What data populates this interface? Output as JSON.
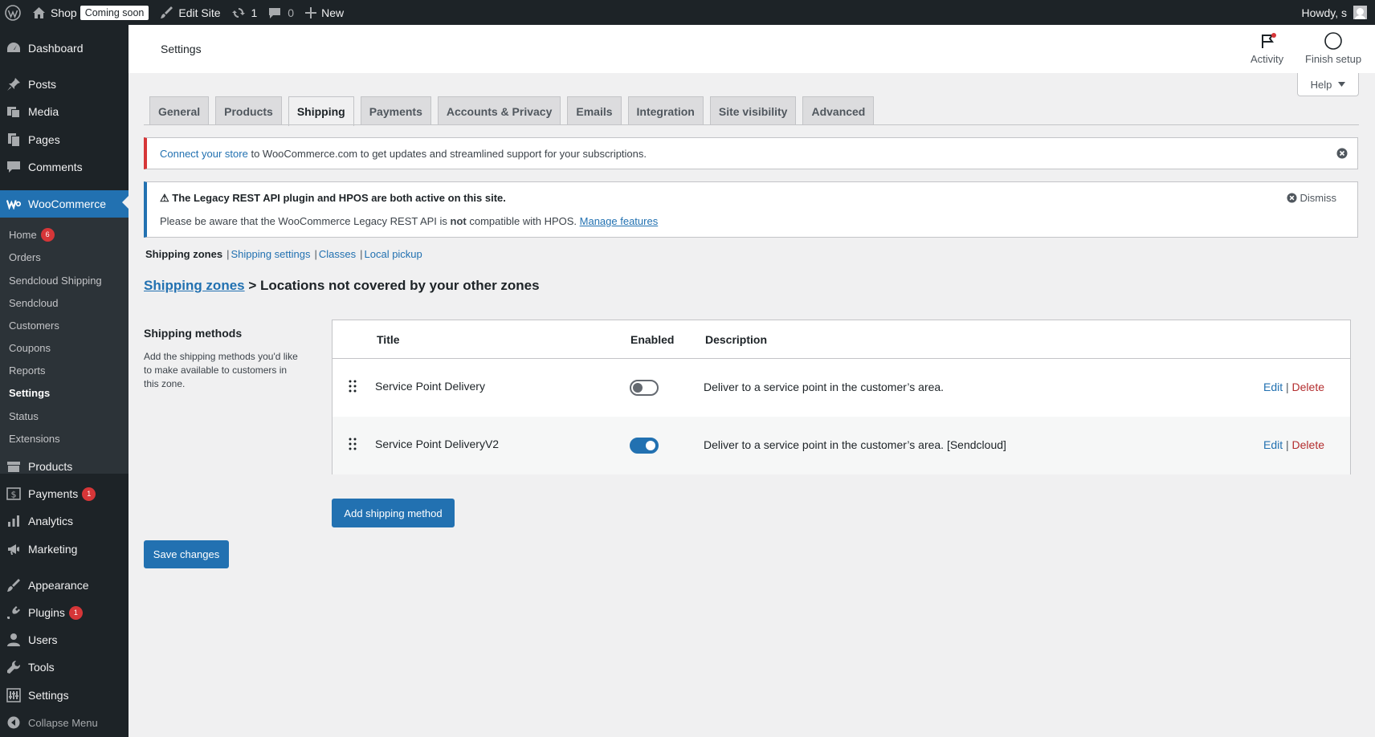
{
  "adminbar": {
    "site_name": "Shop",
    "site_badge": "Coming soon",
    "edit_site": "Edit Site",
    "updates_count": "1",
    "comments_count": "0",
    "new_label": "New",
    "howdy": "Howdy, s"
  },
  "sidebar": {
    "dashboard": "Dashboard",
    "posts": "Posts",
    "media": "Media",
    "pages": "Pages",
    "comments": "Comments",
    "woocommerce": "WooCommerce",
    "submenu": {
      "home": "Home",
      "home_badge": "6",
      "orders": "Orders",
      "sendcloud_shipping": "Sendcloud Shipping",
      "sendcloud": "Sendcloud",
      "customers": "Customers",
      "coupons": "Coupons",
      "reports": "Reports",
      "settings": "Settings",
      "status": "Status",
      "extensions": "Extensions"
    },
    "products": "Products",
    "payments": "Payments",
    "payments_badge": "1",
    "analytics": "Analytics",
    "marketing": "Marketing",
    "appearance": "Appearance",
    "plugins": "Plugins",
    "plugins_badge": "1",
    "users": "Users",
    "tools": "Tools",
    "settings": "Settings",
    "collapse": "Collapse Menu"
  },
  "header": {
    "title": "Settings",
    "activity": "Activity",
    "finish_setup": "Finish setup",
    "help": "Help"
  },
  "tabs": [
    "General",
    "Products",
    "Shipping",
    "Payments",
    "Accounts & Privacy",
    "Emails",
    "Integration",
    "Site visibility",
    "Advanced"
  ],
  "notice_connect": {
    "link": "Connect your store",
    "text": " to WooCommerce.com to get updates and streamlined support for your subscriptions."
  },
  "notice_legacy": {
    "title": "⚠ The Legacy REST API plugin and HPOS are both active on this site.",
    "text_before": "Please be aware that the WooCommerce Legacy REST API is ",
    "text_bold": "not",
    "text_after": " compatible with HPOS. ",
    "link": "Manage features",
    "dismiss": "Dismiss"
  },
  "subnav": {
    "current": "Shipping zones",
    "shipping_settings": "Shipping settings",
    "classes": "Classes",
    "local_pickup": "Local pickup"
  },
  "heading": {
    "link": "Shipping zones",
    "rest": " > Locations not covered by your other zones"
  },
  "shipping_methods": {
    "title": "Shipping methods",
    "description": "Add the shipping methods you'd like to make available to customers in this zone.",
    "columns": {
      "title": "Title",
      "enabled": "Enabled",
      "description": "Description"
    },
    "rows": [
      {
        "title": "Service Point Delivery",
        "enabled": false,
        "description": "Deliver to a service point in the customer’s area.",
        "edit": "Edit",
        "delete": "Delete"
      },
      {
        "title": "Service Point DeliveryV2",
        "enabled": true,
        "description": "Deliver to a service point in the customer’s area. [Sendcloud]",
        "edit": "Edit",
        "delete": "Delete"
      }
    ],
    "add_button": "Add shipping method"
  },
  "save_button": "Save changes"
}
